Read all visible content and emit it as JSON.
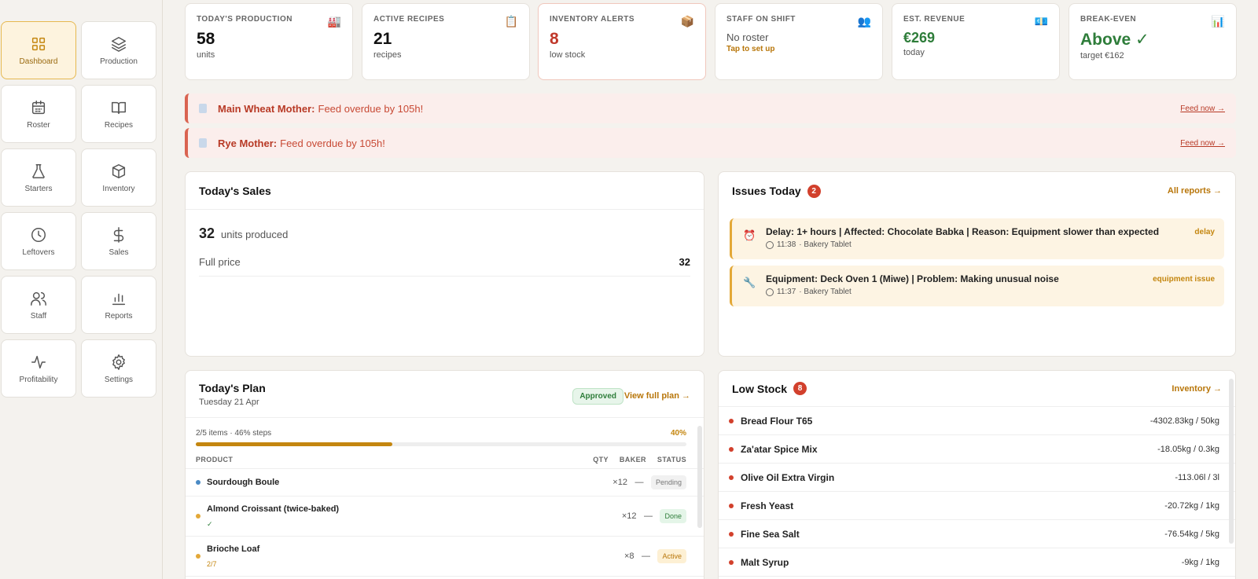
{
  "sidebar": {
    "items": [
      {
        "label": "Dashboard",
        "icon": "grid-icon"
      },
      {
        "label": "Production",
        "icon": "layers-icon"
      },
      {
        "label": "Roster",
        "icon": "calendar-icon"
      },
      {
        "label": "Recipes",
        "icon": "book-icon"
      },
      {
        "label": "Starters",
        "icon": "flask-icon"
      },
      {
        "label": "Inventory",
        "icon": "box-icon"
      },
      {
        "label": "Leftovers",
        "icon": "clock-icon"
      },
      {
        "label": "Sales",
        "icon": "dollar-icon"
      },
      {
        "label": "Staff",
        "icon": "users-icon"
      },
      {
        "label": "Reports",
        "icon": "bar-chart-icon"
      },
      {
        "label": "Profitability",
        "icon": "activity-icon"
      },
      {
        "label": "Settings",
        "icon": "gear-icon"
      }
    ]
  },
  "kpis": [
    {
      "label": "TODAY'S PRODUCTION",
      "icon": "🏭",
      "value": "58",
      "sub": "units"
    },
    {
      "label": "ACTIVE RECIPES",
      "icon": "📋",
      "value": "21",
      "sub": "recipes"
    },
    {
      "label": "INVENTORY ALERTS",
      "icon": "📦",
      "value": "8",
      "sub": "low stock"
    },
    {
      "label": "STAFF ON SHIFT",
      "icon": "👥",
      "value": "No roster",
      "sub": "Tap to set up"
    },
    {
      "label": "EST. REVENUE",
      "icon": "💶",
      "value": "€269",
      "sub": "today"
    },
    {
      "label": "BREAK-EVEN",
      "icon": "📊",
      "value": "Above ✓",
      "sub": "target €162"
    }
  ],
  "alerts": [
    {
      "title": "Main Wheat Mother:",
      "message": "Feed overdue by 105h!",
      "action": "Feed now →"
    },
    {
      "title": "Rye Mother:",
      "message": "Feed overdue by 105h!",
      "action": "Feed now →"
    }
  ],
  "sales": {
    "title": "Today's Sales",
    "units": "32",
    "units_label": "units produced",
    "full_price_label": "Full price",
    "full_price_value": "32"
  },
  "issues": {
    "title": "Issues Today",
    "count": "2",
    "link": "All reports →",
    "items": [
      {
        "icon": "⏰",
        "text": "Delay: 1+ hours | Affected: Chocolate Babka | Reason: Equipment slower than expected",
        "time": "11:38",
        "source": "· Bakery Tablet",
        "tag": "delay"
      },
      {
        "icon": "🔧",
        "text": "Equipment: Deck Oven 1 (Miwe) | Problem: Making unusual noise",
        "time": "11:37",
        "source": "· Bakery Tablet",
        "tag": "equipment issue"
      }
    ]
  },
  "plan": {
    "title": "Today's Plan",
    "date": "Tuesday 21 Apr",
    "status": "Approved",
    "link": "View full plan →",
    "summary": "2/5 items · 46% steps",
    "percent_label": "40%",
    "progress": 0.4,
    "columns": {
      "product": "PRODUCT",
      "qty": "QTY",
      "baker": "BAKER",
      "status": "STATUS"
    },
    "rows": [
      {
        "name": "Sourdough Boule",
        "sub": "",
        "qty": "×12",
        "baker": "—",
        "status": "Pending",
        "dot": "#4a8ac4"
      },
      {
        "name": "Almond Croissant (twice-baked)",
        "sub": "✓",
        "qty": "×12",
        "baker": "—",
        "status": "Done",
        "dot": "#e3a838"
      },
      {
        "name": "Brioche Loaf",
        "sub": "2/7",
        "qty": "×8",
        "baker": "—",
        "status": "Active",
        "dot": "#e3a838"
      }
    ]
  },
  "low_stock": {
    "title": "Low Stock",
    "count": "8",
    "link": "Inventory →",
    "items": [
      {
        "name": "Bread Flour T65",
        "qty": "-4302.83kg / 50kg"
      },
      {
        "name": "Za'atar Spice Mix",
        "qty": "-18.05kg / 0.3kg"
      },
      {
        "name": "Olive Oil Extra Virgin",
        "qty": "-113.06l / 3l"
      },
      {
        "name": "Fresh Yeast",
        "qty": "-20.72kg / 1kg"
      },
      {
        "name": "Fine Sea Salt",
        "qty": "-76.54kg / 5kg"
      },
      {
        "name": "Malt Syrup",
        "qty": "-9kg / 1kg"
      }
    ]
  }
}
